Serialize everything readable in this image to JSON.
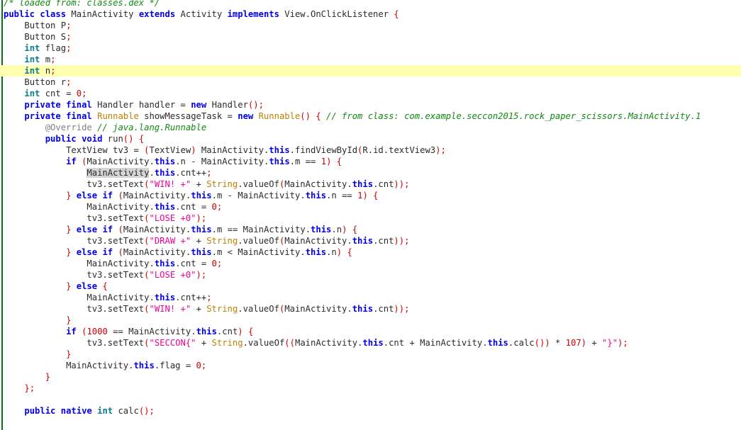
{
  "editor": {
    "kind": "java-decompiler-source-view",
    "background": "#ffffff",
    "gutter_accent_color": "#0a6b12",
    "current_line_highlight_color": "#ffffb0",
    "selection_highlight_color": "#d4d4d4",
    "highlighted_line_index": 6,
    "selected_token": "MainActivity",
    "font_size_px": 12,
    "line_height_px": 16,
    "syntax_colors": {
      "keyword": "#0000ee",
      "primitive_type": "#077d8e",
      "class_name": "#c08000",
      "string": "#ee0099",
      "number": "#cc0000",
      "punctuation": "#cc0000",
      "comment": "#108a10",
      "annotation": "#808080",
      "plain": "#2b2b2b"
    }
  },
  "code": {
    "language": "java",
    "lines": [
      "/* loaded from: classes.dex */",
      "public class MainActivity extends Activity implements View.OnClickListener {",
      "    Button P;",
      "    Button S;",
      "    int flag;",
      "    int m;",
      "    int n;",
      "    Button r;",
      "    int cnt = 0;",
      "    private final Handler handler = new Handler();",
      "    private final Runnable showMessageTask = new Runnable() { // from class: com.example.seccon2015.rock_paper_scissors.MainActivity.1",
      "        @Override // java.lang.Runnable",
      "        public void run() {",
      "            TextView tv3 = (TextView) MainActivity.this.findViewById(R.id.textView3);",
      "            if (MainActivity.this.n - MainActivity.this.m == 1) {",
      "                MainActivity.this.cnt++;",
      "                tv3.setText(\"WIN! +\" + String.valueOf(MainActivity.this.cnt));",
      "            } else if (MainActivity.this.m - MainActivity.this.n == 1) {",
      "                MainActivity.this.cnt = 0;",
      "                tv3.setText(\"LOSE +0\");",
      "            } else if (MainActivity.this.m == MainActivity.this.n) {",
      "                tv3.setText(\"DRAW +\" + String.valueOf(MainActivity.this.cnt));",
      "            } else if (MainActivity.this.m < MainActivity.this.n) {",
      "                MainActivity.this.cnt = 0;",
      "                tv3.setText(\"LOSE +0\");",
      "            } else {",
      "                MainActivity.this.cnt++;",
      "                tv3.setText(\"WIN! +\" + String.valueOf(MainActivity.this.cnt));",
      "            }",
      "            if (1000 == MainActivity.this.cnt) {",
      "                tv3.setText(\"SECCON{\" + String.valueOf((MainActivity.this.cnt + MainActivity.this.calc()) * 107) + \"}\");",
      "            }",
      "            MainActivity.this.flag = 0;",
      "        }",
      "    };",
      "",
      "    public native int calc();",
      ""
    ],
    "string_literals": [
      "WIN! +",
      "LOSE +0",
      "DRAW +",
      "LOSE +0",
      "WIN! +",
      "SECCON{",
      "}"
    ],
    "numeric_literals": [
      "0",
      "1",
      "1",
      "0",
      "0",
      "1000",
      "107",
      "0"
    ],
    "comments": [
      "/* loaded from: classes.dex */",
      "// from class: com.example.seccon2015.rock_paper_scissors.MainActivity.1",
      "// java.lang.Runnable"
    ],
    "annotations": [
      "@Override"
    ],
    "class_name": "MainActivity",
    "superclass": "Activity",
    "interface": "View.OnClickListener",
    "fields": [
      "Button P;",
      "Button S;",
      "int flag;",
      "int m;",
      "int n;",
      "Button r;",
      "int cnt = 0;"
    ],
    "native_method": "public native int calc();"
  }
}
